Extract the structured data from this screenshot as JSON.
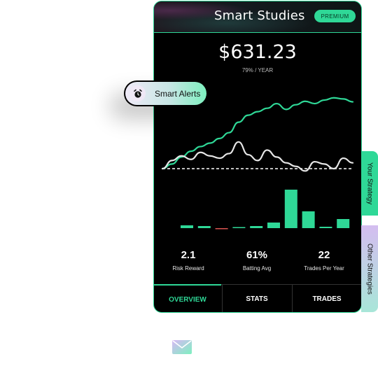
{
  "card": {
    "title": "Smart Studies",
    "badge": "PREMIUM",
    "value": "$631.23",
    "rate": "79% / YEAR"
  },
  "alert": {
    "label": "Smart Alerts",
    "icon": "alarm-clock-icon"
  },
  "stats": [
    {
      "value": "2.1",
      "label": "Risk Reward"
    },
    {
      "value": "61%",
      "label": "Batting Avg"
    },
    {
      "value": "22",
      "label": "Trades Per Year"
    }
  ],
  "tabs": [
    {
      "label": "OVERVIEW",
      "active": true
    },
    {
      "label": "STATS",
      "active": false
    },
    {
      "label": "TRADES",
      "active": false
    }
  ],
  "side_tabs": [
    {
      "label": "Your Strategy"
    },
    {
      "label": "Other Strategies"
    }
  ],
  "colors": {
    "accent": "#2fd897",
    "negative": "#d9534f",
    "background": "#000000"
  },
  "chart_data": {
    "type": "line",
    "series": [
      {
        "values": [
          0,
          8,
          20,
          30,
          38,
          44,
          52,
          62,
          80,
          92,
          98,
          104,
          112,
          102,
          110,
          116,
          112,
          118,
          122,
          120,
          115
        ]
      },
      {
        "values": [
          0,
          14,
          22,
          16,
          28,
          22,
          18,
          26,
          46,
          24,
          14,
          32,
          20,
          10,
          4,
          -4,
          12,
          8,
          0,
          18,
          10
        ]
      }
    ],
    "bars": [
      {
        "value": 4,
        "color": "#2fd897"
      },
      {
        "value": 3,
        "color": "#2fd897"
      },
      {
        "value": -1,
        "color": "#d9534f"
      },
      {
        "value": 1,
        "color": "#2fd897"
      },
      {
        "value": 3,
        "color": "#2fd897"
      },
      {
        "value": 8,
        "color": "#2fd897"
      },
      {
        "value": 55,
        "color": "#2fd897"
      },
      {
        "value": 24,
        "color": "#2fd897"
      },
      {
        "value": 2,
        "color": "#2fd897"
      },
      {
        "value": 13,
        "color": "#2fd897"
      }
    ]
  }
}
